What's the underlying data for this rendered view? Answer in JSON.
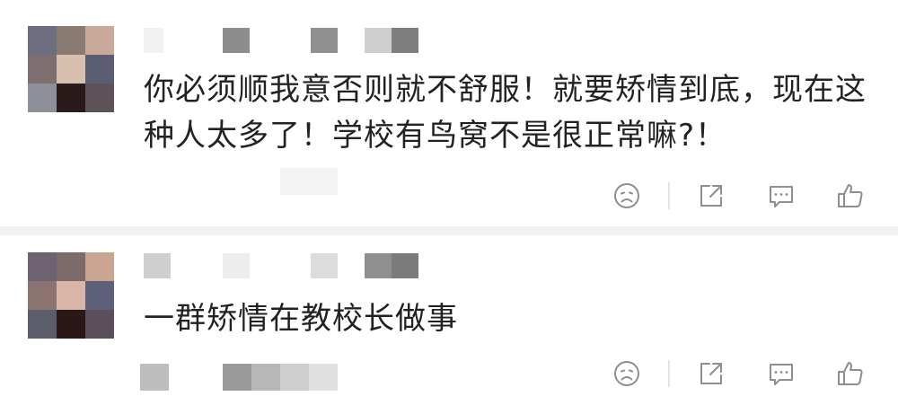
{
  "comments": [
    {
      "author": "",
      "text": "你必须顺我意否则就不舒服！就要矫情到底，现在这种人太多了！学校有鸟窝不是很正常嘛?！",
      "actions": [
        "dislike-icon",
        "share-icon",
        "reply-icon",
        "like-icon"
      ]
    },
    {
      "author": "",
      "text": "一群矫情在教校长做事",
      "actions": [
        "dislike-icon",
        "share-icon",
        "reply-icon",
        "like-icon"
      ]
    }
  ],
  "colors": {
    "text": "#222222",
    "icon": "#8e8e8e",
    "divider": "#f1f1f1"
  }
}
